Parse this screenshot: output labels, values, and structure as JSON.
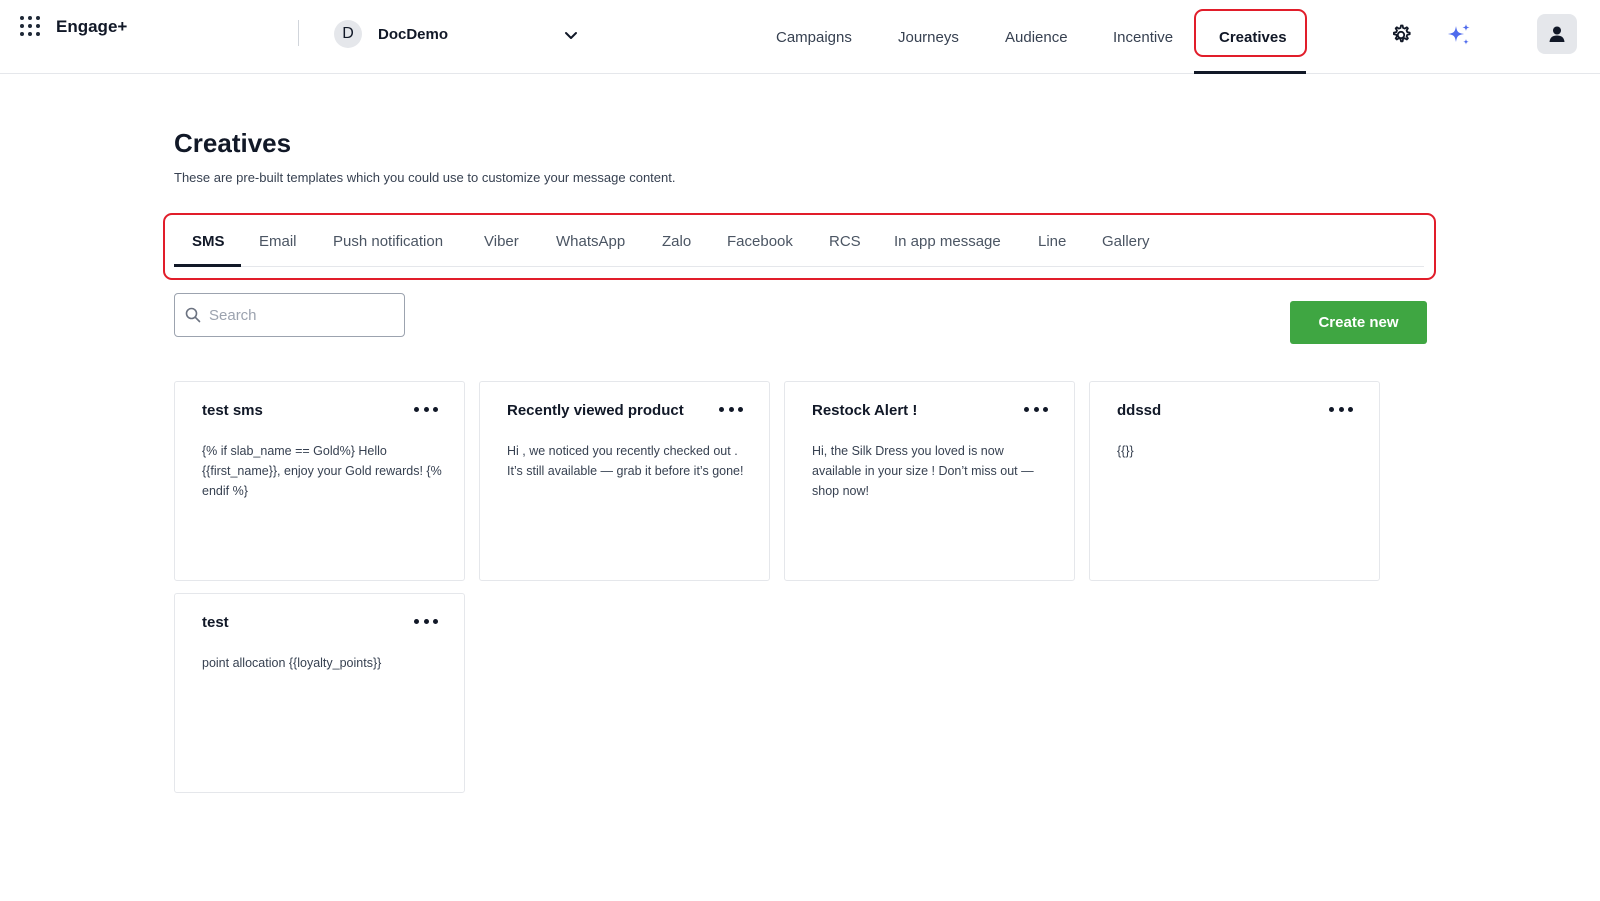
{
  "header": {
    "brand": "Engage+",
    "org_initial": "D",
    "org_name": "DocDemo",
    "nav": [
      {
        "label": "Campaigns"
      },
      {
        "label": "Journeys"
      },
      {
        "label": "Audience"
      },
      {
        "label": "Incentive"
      },
      {
        "label": "Creatives",
        "active": true
      }
    ]
  },
  "page": {
    "title": "Creatives",
    "subtitle": "These are pre-built templates which you could use to customize your message content."
  },
  "tabs": [
    {
      "label": "SMS",
      "active": true
    },
    {
      "label": "Email"
    },
    {
      "label": "Push notification"
    },
    {
      "label": "Viber"
    },
    {
      "label": "WhatsApp"
    },
    {
      "label": "Zalo"
    },
    {
      "label": "Facebook"
    },
    {
      "label": "RCS"
    },
    {
      "label": "In app message"
    },
    {
      "label": "Line"
    },
    {
      "label": "Gallery"
    }
  ],
  "search": {
    "placeholder": "Search",
    "value": ""
  },
  "create_button": "Create new",
  "cards": [
    {
      "title": "test sms",
      "body": "{% if slab_name == Gold%} Hello {{first_name}}, enjoy your Gold rewards! {% endif %}"
    },
    {
      "title": "Recently viewed product",
      "body": "Hi , we noticed you recently checked out . It’s still available — grab it before it’s gone!"
    },
    {
      "title": "Restock Alert !",
      "body": "Hi, the Silk Dress you loved is now available in your size ! Don’t miss out — shop now!"
    },
    {
      "title": "ddssd",
      "body": "{{}}"
    },
    {
      "title": "test",
      "body": "point allocation {{loyalty_points}}"
    }
  ],
  "colors": {
    "accent_green": "#3fa642",
    "highlight_red": "#e11d2a",
    "ai_sparkle": "#4f6bed"
  }
}
